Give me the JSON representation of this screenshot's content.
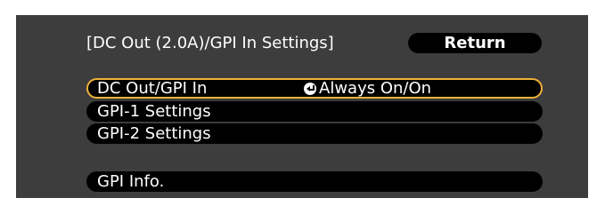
{
  "dialog": {
    "title": "[DC Out (2.0A)/GPI In Settings]",
    "return_label": "Return"
  },
  "menu": {
    "items": [
      {
        "label": "DC Out/GPI In",
        "value": "Always On/On",
        "selected": true
      },
      {
        "label": "GPI-1 Settings",
        "value": ""
      },
      {
        "label": "GPI-2 Settings",
        "value": ""
      },
      {
        "label": "GPI Info.",
        "value": ""
      }
    ]
  },
  "colors": {
    "background": "#3d3d3d",
    "row": "#000000",
    "highlight": "#f0b23a",
    "text": "#ffffff"
  },
  "icons": {
    "value_icon": "enter-icon"
  }
}
